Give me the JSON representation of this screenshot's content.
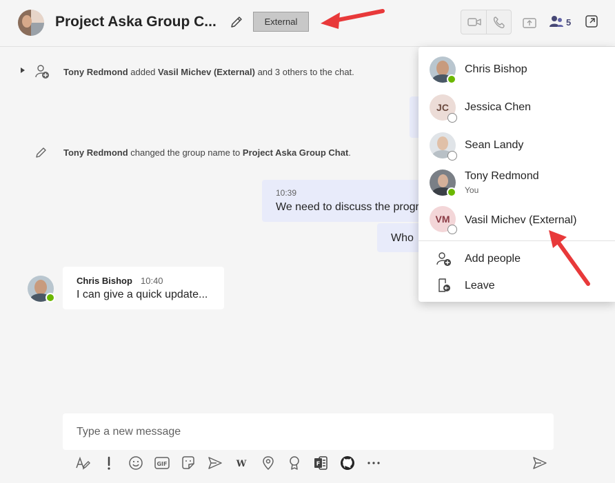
{
  "header": {
    "title": "Project Aska Group C...",
    "external_badge": "External",
    "participant_count": "5"
  },
  "timeline": {
    "event_added": {
      "actor": "Tony Redmond",
      "verb": "added",
      "target": "Vasil Michev (External)",
      "suffix": "and 3 others to the chat."
    },
    "event_renamed": {
      "actor": "Tony Redmond",
      "verb": "changed the group name to",
      "new_name": "Project Aska Group Chat",
      "suffix": "."
    },
    "message_mine": {
      "time": "10:39",
      "text": "We need to discuss the progress"
    },
    "message_mine_2": {
      "text": "Who"
    },
    "message_other": {
      "sender": "Chris Bishop",
      "time": "10:40",
      "text": "I can give a quick update..."
    }
  },
  "compose": {
    "placeholder": "Type a new message"
  },
  "toolbar": {
    "icons": [
      "format-icon",
      "important-icon",
      "emoji-icon",
      "gif-icon",
      "sticker-icon",
      "schedule-meeting-icon",
      "wiki-icon",
      "location-icon",
      "praise-icon",
      "forms-icon",
      "github-icon",
      "more-options-icon",
      "send-icon"
    ]
  },
  "participants": [
    {
      "name": "Chris Bishop",
      "sub": "",
      "initials": "",
      "status": "available"
    },
    {
      "name": "Jessica Chen",
      "sub": "",
      "initials": "JC",
      "status": "offline"
    },
    {
      "name": "Sean Landy",
      "sub": "",
      "initials": "",
      "status": "offline"
    },
    {
      "name": "Tony Redmond",
      "sub": "You",
      "initials": "",
      "status": "available"
    },
    {
      "name": "Vasil Michev (External)",
      "sub": "",
      "initials": "VM",
      "status": "offline"
    }
  ],
  "panel_actions": {
    "add_people": "Add people",
    "leave": "Leave"
  },
  "colors": {
    "accent": "#464775",
    "bubble_mine": "#e8ebfa",
    "presence_available": "#6bb700",
    "annotation_arrow": "#e8393a"
  }
}
